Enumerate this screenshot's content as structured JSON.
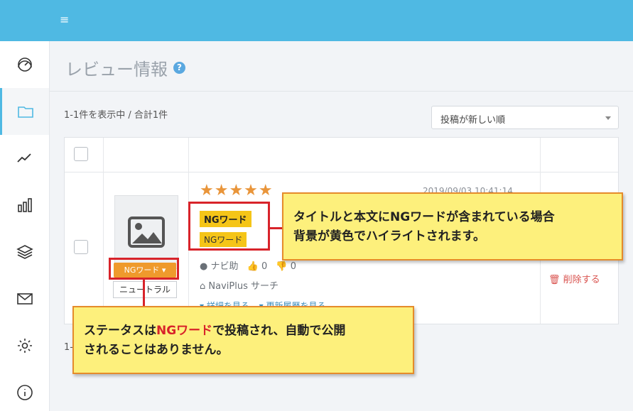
{
  "topbar": {
    "menu_icon": "hamburger-icon",
    "color": "#4fb9e3"
  },
  "sidebar": {
    "items": [
      {
        "icon": "dashboard-gauge-icon"
      },
      {
        "icon": "folder-icon",
        "active": true
      },
      {
        "icon": "trend-line-icon"
      },
      {
        "icon": "bar-chart-icon"
      },
      {
        "icon": "layers-icon"
      },
      {
        "icon": "mail-icon"
      },
      {
        "icon": "gear-icon"
      },
      {
        "icon": "info-icon"
      }
    ]
  },
  "header": {
    "title": "レビュー情報",
    "help": "?"
  },
  "list": {
    "count_text": "1-1件を表示中 / 合計1件",
    "count_text_bottom": "1-",
    "sort": {
      "selected": "投稿が新しい順"
    }
  },
  "review": {
    "rating": 5,
    "stars": "★★★★★",
    "date": "2019/09/03 10:41:14",
    "title": "NGワード",
    "body": "NGワード",
    "status_label": "NGワード ▾",
    "sentiment": "ニュートラル",
    "author": "ナビ助",
    "likes": "0",
    "dislikes": "0",
    "site": "NaviPlus サーチ",
    "detail_link": "▾ 詳細を見る",
    "history_link": "▾ 更新履歴を見る",
    "delete_label": "削除する"
  },
  "callouts": {
    "highlight_line1": "タイトルと本文にNGワードが含まれている場合",
    "highlight_line2": "背景が黄色でハイライトされます。",
    "status_pre": "ステータスは",
    "status_ng": "NGワード",
    "status_post": "で投稿され、自動で公開",
    "status_line2": "されることはありません。"
  },
  "colors": {
    "accent": "#4fb9e3",
    "ng_highlight": "#f5c518",
    "status_orange": "#ef9a2c",
    "annotation_red": "#d8232a",
    "callout_fill": "#fdf07c"
  }
}
